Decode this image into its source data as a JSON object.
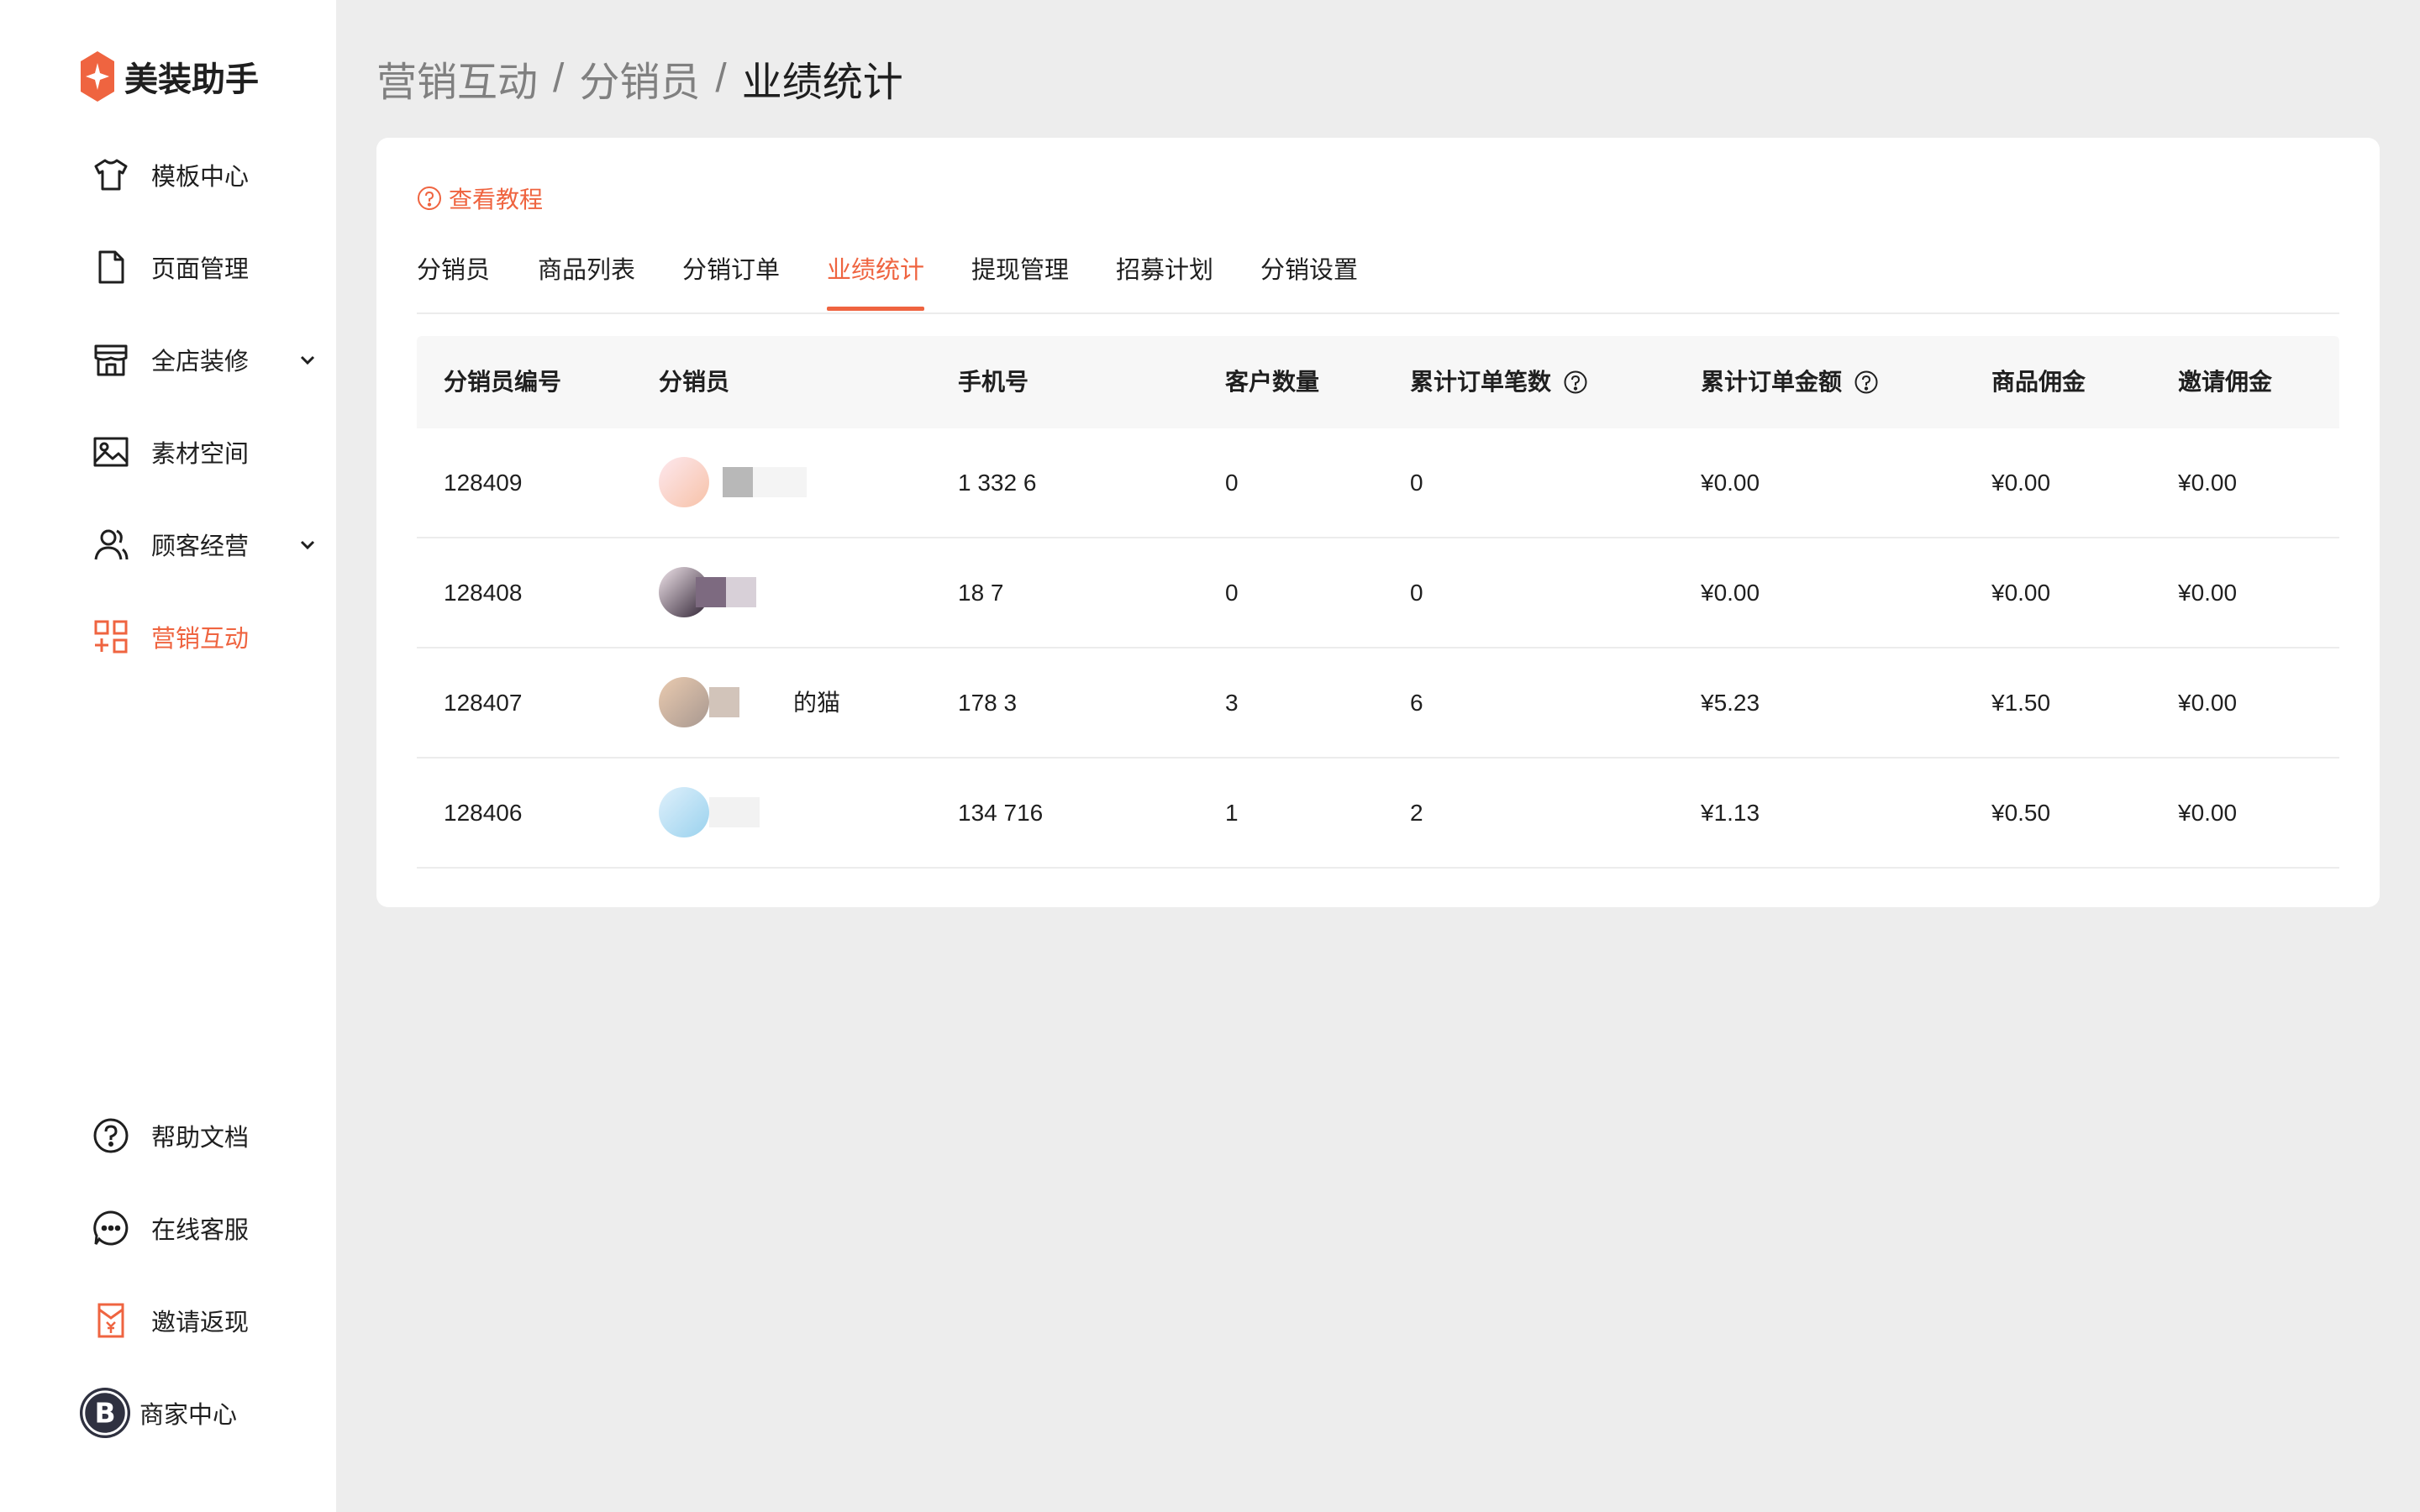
{
  "app": {
    "name": "美装助手",
    "brand_color": "#ef6440"
  },
  "sidebar": {
    "items": [
      {
        "label": "模板中心",
        "icon": "tshirt-icon",
        "active": false,
        "expandable": false
      },
      {
        "label": "页面管理",
        "icon": "document-icon",
        "active": false,
        "expandable": false
      },
      {
        "label": "全店装修",
        "icon": "store-icon",
        "active": false,
        "expandable": true
      },
      {
        "label": "素材空间",
        "icon": "image-icon",
        "active": false,
        "expandable": false
      },
      {
        "label": "顾客经营",
        "icon": "users-icon",
        "active": false,
        "expandable": true
      },
      {
        "label": "营销互动",
        "icon": "grid-plus-icon",
        "active": true,
        "expandable": false
      }
    ],
    "bottom_items": [
      {
        "label": "帮助文档",
        "icon": "question-circle-icon"
      },
      {
        "label": "在线客服",
        "icon": "chat-bubble-icon"
      },
      {
        "label": "邀请返现",
        "icon": "red-envelope-icon"
      },
      {
        "label": "商家中心",
        "icon": "merchant-avatar-icon"
      }
    ]
  },
  "breadcrumb": {
    "items": [
      "营销互动",
      "分销员"
    ],
    "current": "业绩统计",
    "separator": "/"
  },
  "tutorial_link": "查看教程",
  "tabs": [
    {
      "label": "分销员",
      "active": false
    },
    {
      "label": "商品列表",
      "active": false
    },
    {
      "label": "分销订单",
      "active": false
    },
    {
      "label": "业绩统计",
      "active": true
    },
    {
      "label": "提现管理",
      "active": false
    },
    {
      "label": "招募计划",
      "active": false
    },
    {
      "label": "分销设置",
      "active": false
    }
  ],
  "table": {
    "columns": [
      "分销员编号",
      "分销员",
      "手机号",
      "客户数量",
      "累计订单笔数",
      "累计订单金额",
      "商品佣金",
      "邀请佣金"
    ],
    "rows": [
      {
        "id": "128409",
        "name": "",
        "phone": "1    332  6",
        "customers": "0",
        "orders": "0",
        "amount": "¥0.00",
        "product_commission": "¥0.00",
        "invite_commission": "¥0.00"
      },
      {
        "id": "128408",
        "name": "",
        "phone": "18      7",
        "customers": "0",
        "orders": "0",
        "amount": "¥0.00",
        "product_commission": "¥0.00",
        "invite_commission": "¥0.00"
      },
      {
        "id": "128407",
        "name": "的猫",
        "phone": "178    3",
        "customers": "3",
        "orders": "6",
        "amount": "¥5.23",
        "product_commission": "¥1.50",
        "invite_commission": "¥0.00"
      },
      {
        "id": "128406",
        "name": "",
        "phone": "134    716",
        "customers": "1",
        "orders": "2",
        "amount": "¥1.13",
        "product_commission": "¥0.50",
        "invite_commission": "¥0.00"
      }
    ]
  }
}
